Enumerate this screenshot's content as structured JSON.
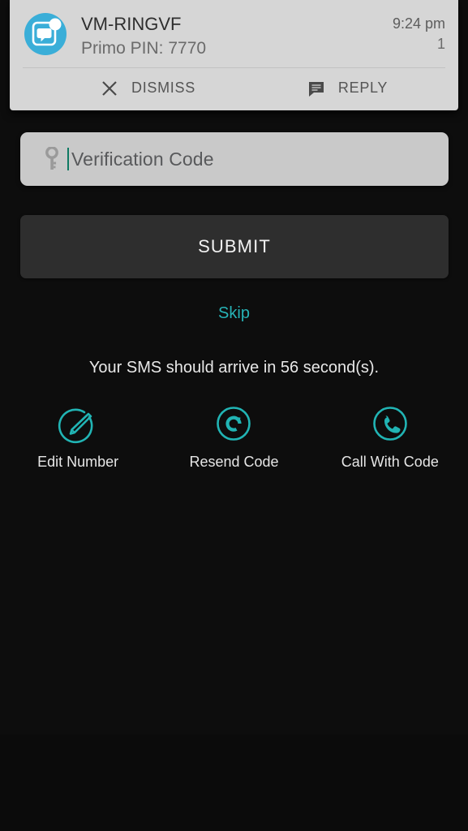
{
  "screen": {
    "background_color": "#0d0d0d",
    "accent_color": "#27b3b6"
  },
  "notification": {
    "app_icon": "message-bubble-icon",
    "title": "VM-RINGVF",
    "body": "Primo PIN: 7770",
    "time": "9:24 pm",
    "count": "1",
    "actions": [
      {
        "icon": "close-icon",
        "label": "DISMISS"
      },
      {
        "icon": "reply-message-icon",
        "label": "REPLY"
      }
    ]
  },
  "verification": {
    "input": {
      "icon": "key-icon",
      "value": "",
      "placeholder": "Verification Code"
    },
    "submit_label": "SUBMIT",
    "skip_label": "Skip",
    "sms_notice": "Your SMS should arrive in 56 second(s).",
    "actions": [
      {
        "icon": "edit-pencil-circle-icon",
        "label": "Edit Number"
      },
      {
        "icon": "refresh-circle-icon",
        "label": "Resend Code"
      },
      {
        "icon": "phone-circle-icon",
        "label": "Call With Code"
      }
    ]
  }
}
